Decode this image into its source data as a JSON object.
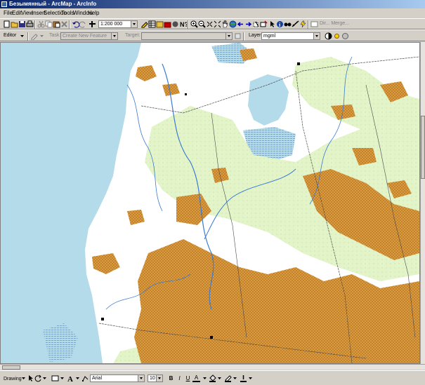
{
  "window": {
    "title": "Безымянный - ArcMap - ArcInfo"
  },
  "menu": {
    "items": [
      "File",
      "Edit",
      "View",
      "Insert",
      "Selection",
      "Tools",
      "Window",
      "Help"
    ]
  },
  "standard_toolbar": {
    "scale_value": "1:200 000"
  },
  "editor_toolbar": {
    "editor_label": "Editor",
    "task_label": "Task:",
    "task_value": "Create New Feature",
    "target_label": "Target:",
    "target_value": ""
  },
  "georef_toolbar": {
    "layer_label": "Layer:",
    "layer_value": "mgml"
  },
  "drawing_toolbar": {
    "drawing_label": "Drawing",
    "font_value": "Arial",
    "size_value": "10",
    "bold_label": "B",
    "italic_label": "I",
    "underline_label": "U",
    "font_color_label": "A"
  },
  "map": {
    "colors": {
      "water": "#b4dbea",
      "sand": "#dc9a3c",
      "meadow": "#e2f4c8",
      "land": "#ffffff",
      "river": "#3a7bd5",
      "road": "#4a4a4a"
    }
  },
  "icons": [
    "new-icon",
    "open-icon",
    "save-icon",
    "print-icon",
    "cut-icon",
    "copy-icon",
    "paste-icon",
    "delete-icon",
    "undo-icon",
    "redo-icon",
    "add-data-icon",
    "zoom-in-icon",
    "zoom-out-icon",
    "pan-icon",
    "full-extent-icon",
    "identify-icon",
    "find-icon",
    "measure-icon",
    "help-icon",
    "sketch-icon",
    "select-arrow-icon",
    "rotate-icon",
    "text-tool-icon",
    "rectangle-icon",
    "fill-color-icon",
    "line-color-icon"
  ]
}
